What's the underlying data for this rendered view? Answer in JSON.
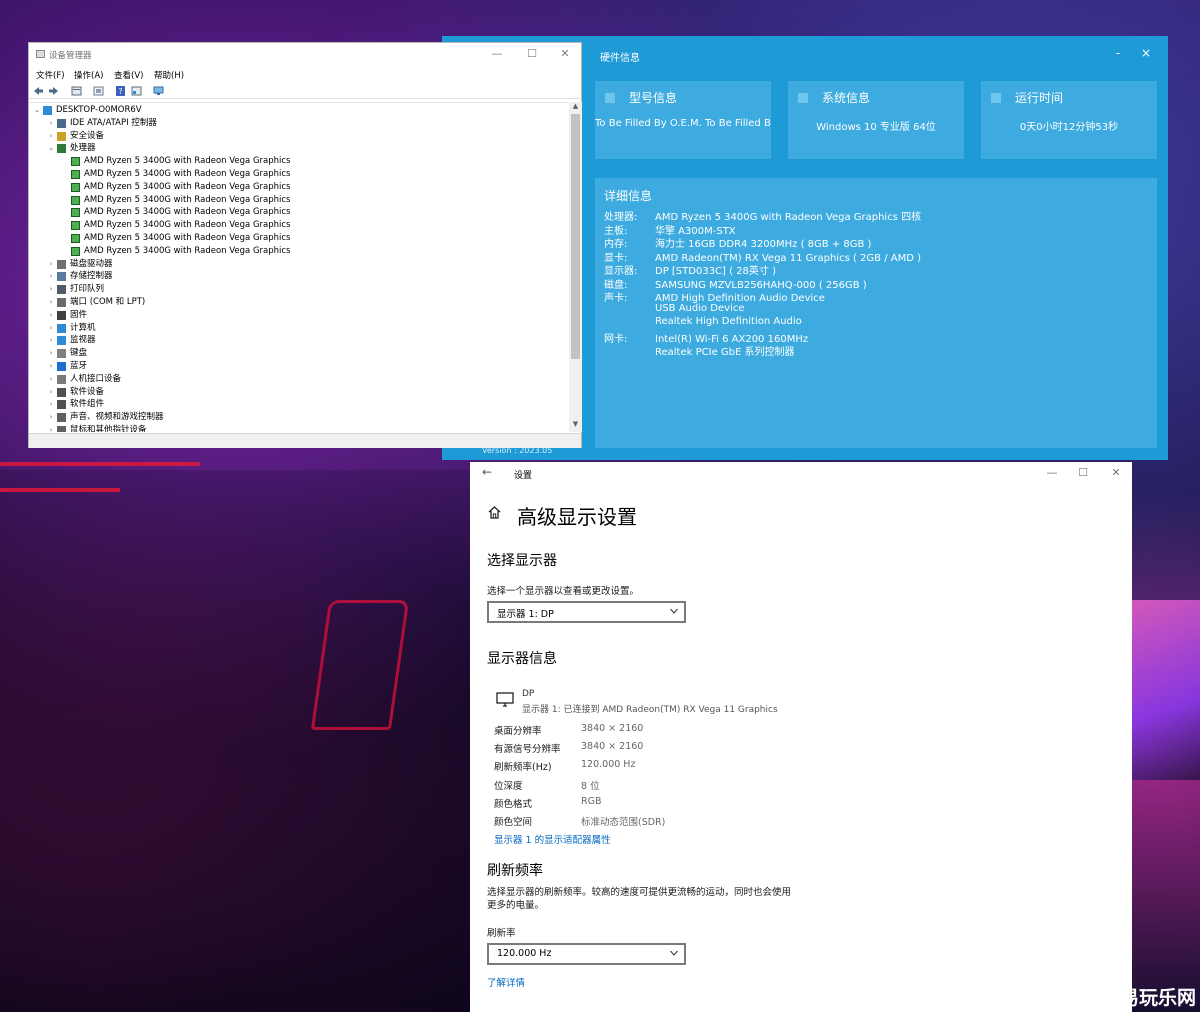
{
  "desktop": {
    "watermark": "易玩乐网"
  },
  "hardware_info": {
    "title": "硬件信息",
    "minimize": "-",
    "close": "×",
    "cards": [
      {
        "title": "型号信息",
        "value": "To Be Filled By O.E.M. To Be Filled By"
      },
      {
        "title": "系统信息",
        "value": "Windows 10 专业版 64位"
      },
      {
        "title": "运行时间",
        "value": "0天0小时12分钟53秒"
      }
    ],
    "detail_title": "详细信息",
    "details": [
      {
        "label": "处理器:",
        "value": "AMD Ryzen 5 3400G with Radeon Vega Graphics 四核"
      },
      {
        "label": "主板:",
        "value": "华擎 A300M-STX"
      },
      {
        "label": "内存:",
        "value": "海力士 16GB DDR4 3200MHz ( 8GB + 8GB )"
      },
      {
        "label": "显卡:",
        "value": "AMD Radeon(TM) RX Vega 11 Graphics ( 2GB / AMD )"
      },
      {
        "label": "显示器:",
        "value": "DP [STD033C] ( 28英寸 )"
      },
      {
        "label": "磁盘:",
        "value": "SAMSUNG MZVLB256HAHQ-000 ( 256GB )"
      },
      {
        "label": "声卡:",
        "value": "AMD High Definition Audio Device"
      },
      {
        "label": "",
        "value": "USB Audio Device"
      },
      {
        "label": "",
        "value": "Realtek High Definition Audio"
      },
      {
        "label": "网卡:",
        "value": "Intel(R) Wi-Fi 6 AX200 160MHz"
      },
      {
        "label": "",
        "value": "Realtek PCIe GbE 系列控制器"
      }
    ],
    "version": "Version : 2023.05"
  },
  "device_manager": {
    "title": "设备管理器",
    "controls": {
      "minimize": "—",
      "maximize": "☐",
      "close": "✕"
    },
    "menu": [
      "文件(F)",
      "操作(A)",
      "查看(V)",
      "帮助(H)"
    ],
    "root": "DESKTOP-O0MOR6V",
    "nodes": [
      {
        "label": "IDE ATA/ATAPI 控制器",
        "expanded": false,
        "color": "#4a6a8a"
      },
      {
        "label": "安全设备",
        "expanded": false,
        "color": "#c9a227"
      },
      {
        "label": "处理器",
        "expanded": true,
        "color": "#2f7a3a"
      },
      {
        "label": "磁盘驱动器",
        "expanded": false,
        "color": "#707070"
      },
      {
        "label": "存储控制器",
        "expanded": false,
        "color": "#5a7aa0"
      },
      {
        "label": "打印队列",
        "expanded": false,
        "color": "#505a6a"
      },
      {
        "label": "端口 (COM 和 LPT)",
        "expanded": false,
        "color": "#6a6a6a"
      },
      {
        "label": "固件",
        "expanded": false,
        "color": "#404040"
      },
      {
        "label": "计算机",
        "expanded": false,
        "color": "#2e8bd6"
      },
      {
        "label": "监视器",
        "expanded": false,
        "color": "#2e8bd6"
      },
      {
        "label": "键盘",
        "expanded": false,
        "color": "#808080"
      },
      {
        "label": "蓝牙",
        "expanded": false,
        "color": "#1f6fd0"
      },
      {
        "label": "人机接口设备",
        "expanded": false,
        "color": "#7a7a7a"
      },
      {
        "label": "软件设备",
        "expanded": false,
        "color": "#505050"
      },
      {
        "label": "软件组件",
        "expanded": false,
        "color": "#505050"
      },
      {
        "label": "声音、视频和游戏控制器",
        "expanded": false,
        "color": "#606060"
      },
      {
        "label": "鼠标和其他指针设备",
        "expanded": false,
        "color": "#606060"
      }
    ],
    "processors": [
      "AMD Ryzen 5 3400G with Radeon Vega Graphics",
      "AMD Ryzen 5 3400G with Radeon Vega Graphics",
      "AMD Ryzen 5 3400G with Radeon Vega Graphics",
      "AMD Ryzen 5 3400G with Radeon Vega Graphics",
      "AMD Ryzen 5 3400G with Radeon Vega Graphics",
      "AMD Ryzen 5 3400G with Radeon Vega Graphics",
      "AMD Ryzen 5 3400G with Radeon Vega Graphics",
      "AMD Ryzen 5 3400G with Radeon Vega Graphics"
    ]
  },
  "settings": {
    "window_title": "设置",
    "back": "←",
    "controls": {
      "minimize": "—",
      "maximize": "☐",
      "close": "✕"
    },
    "page_title": "高级显示设置",
    "select_display": {
      "heading": "选择显示器",
      "description": "选择一个显示器以查看或更改设置。",
      "selected": "显示器 1: DP"
    },
    "display_info": {
      "heading": "显示器信息",
      "monitor_name": "DP",
      "monitor_sub": "显示器 1: 已连接到 AMD Radeon(TM) RX Vega 11 Graphics",
      "rows": [
        {
          "key": "桌面分辨率",
          "value": "3840 × 2160"
        },
        {
          "key": "有源信号分辨率",
          "value": "3840 × 2160"
        },
        {
          "key": "刷新频率(Hz)",
          "value": "120.000 Hz"
        },
        {
          "key": "位深度",
          "value": "8 位"
        },
        {
          "key": "颜色格式",
          "value": "RGB"
        },
        {
          "key": "颜色空间",
          "value": "标准动态范围(SDR)"
        }
      ],
      "adapter_link": "显示器 1 的显示适配器属性"
    },
    "refresh_rate": {
      "heading": "刷新频率",
      "description_line1": "选择显示器的刷新频率。较高的速度可提供更流畅的运动，同时也会使用",
      "description_line2": "更多的电量。",
      "label": "刷新率",
      "selected": "120.000 Hz",
      "learn_more": "了解详情"
    }
  }
}
